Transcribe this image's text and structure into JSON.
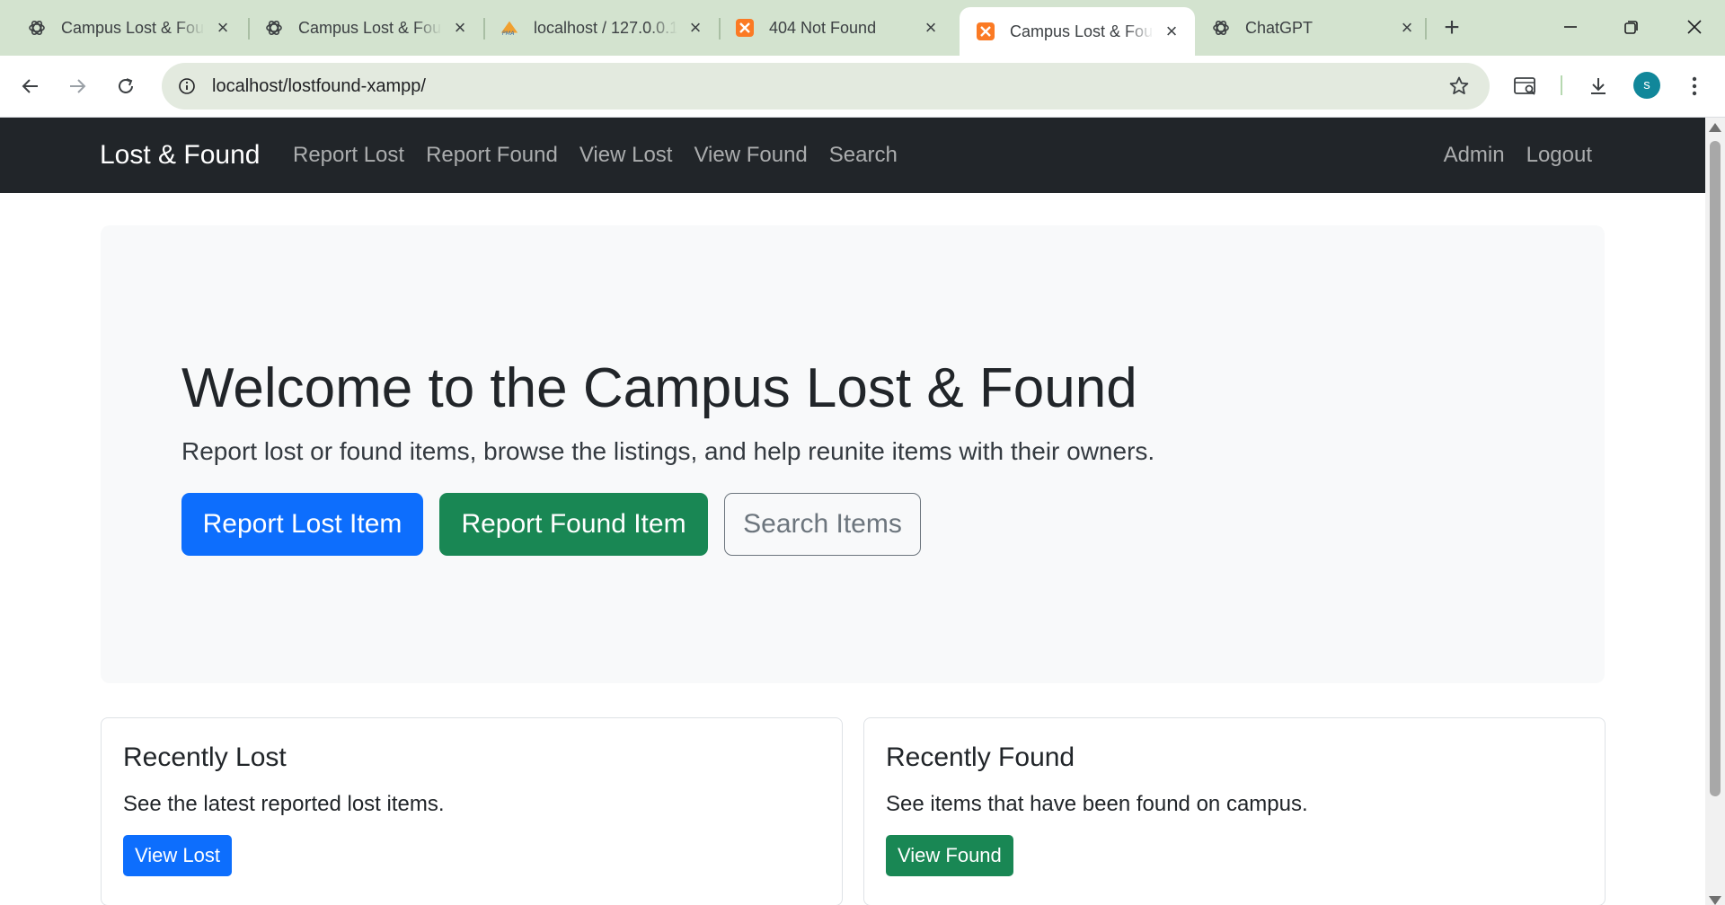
{
  "browser": {
    "tabs": [
      {
        "title": "Campus Lost & Found",
        "favicon": "chatgpt-icon",
        "active": false
      },
      {
        "title": "Campus Lost & Found",
        "favicon": "chatgpt-icon",
        "active": false
      },
      {
        "title": "localhost / 127.0.0.1",
        "favicon": "phpmyadmin-icon",
        "active": false
      },
      {
        "title": "404 Not Found",
        "favicon": "xampp-icon",
        "active": false
      },
      {
        "title": "Campus Lost & Found",
        "favicon": "xampp-icon",
        "active": true
      },
      {
        "title": "ChatGPT",
        "favicon": "chatgpt-icon",
        "active": false
      }
    ],
    "url": "localhost/lostfound-xampp/",
    "profile_initial": "s",
    "colors": {
      "tabstrip": "#d3e3cf",
      "omnibox": "#e3eadf",
      "avatar": "#11879a"
    }
  },
  "nav": {
    "brand": "Lost & Found",
    "links": [
      "Report Lost",
      "Report Found",
      "View Lost",
      "View Found",
      "Search"
    ],
    "right_links": [
      "Admin",
      "Logout"
    ]
  },
  "hero": {
    "title": "Welcome to the Campus Lost & Found",
    "lead": "Report lost or found items, browse the listings, and help reunite items with their owners.",
    "buttons": [
      "Report Lost Item",
      "Report Found Item",
      "Search Items"
    ]
  },
  "cards": [
    {
      "title": "Recently Lost",
      "text": "See the latest reported lost items.",
      "button": "View Lost",
      "button_color": "#0d6efd"
    },
    {
      "title": "Recently Found",
      "text": "See items that have been found on campus.",
      "button": "View Found",
      "button_color": "#198754"
    }
  ]
}
